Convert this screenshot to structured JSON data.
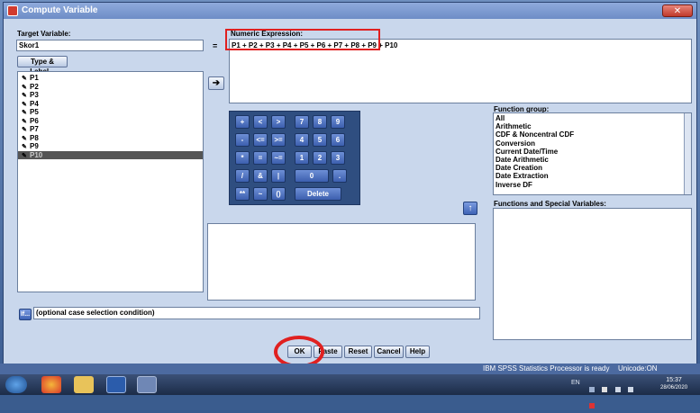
{
  "window": {
    "title": "Compute Variable",
    "close_label": "✕"
  },
  "target": {
    "label": "Target Variable:",
    "value": "Skor1",
    "type_label_button": "Type & Label...",
    "equals": "="
  },
  "expression": {
    "label": "Numeric Expression:",
    "value": "P1 + P2 + P3 + P4 + P5 + P6 + P7 + P8 + P9 + P10"
  },
  "variables": [
    "P1",
    "P2",
    "P3",
    "P4",
    "P5",
    "P6",
    "P7",
    "P8",
    "P9",
    "P10"
  ],
  "selected_variable": "P10",
  "move_arrow": "➔",
  "keypad": {
    "row1": [
      "+",
      "<",
      ">",
      "7",
      "8",
      "9"
    ],
    "row2": [
      "-",
      "<=",
      ">=",
      "4",
      "5",
      "6"
    ],
    "row3": [
      "*",
      "=",
      "~=",
      "1",
      "2",
      "3"
    ],
    "row4": [
      "/",
      "&",
      "|",
      "0",
      "."
    ],
    "row5": [
      "**",
      "~",
      "()",
      "Delete"
    ]
  },
  "function_group": {
    "label": "Function group:",
    "items": [
      "All",
      "Arithmetic",
      "CDF & Noncentral CDF",
      "Conversion",
      "Current Date/Time",
      "Date Arithmetic",
      "Date Creation",
      "Date Extraction",
      "Inverse DF"
    ]
  },
  "functions_label": "Functions and Special Variables:",
  "if_button": "If...",
  "if_condition": "(optional case selection condition)",
  "buttons": {
    "ok": "OK",
    "paste": "Paste",
    "reset": "Reset",
    "cancel": "Cancel",
    "help": "Help"
  },
  "status": {
    "processor": "IBM SPSS Statistics Processor is ready",
    "unicode": "Unicode:ON"
  },
  "taskbar": {
    "clock_time": "15:37",
    "clock_date": "28/06/2020",
    "lang": "EN"
  }
}
